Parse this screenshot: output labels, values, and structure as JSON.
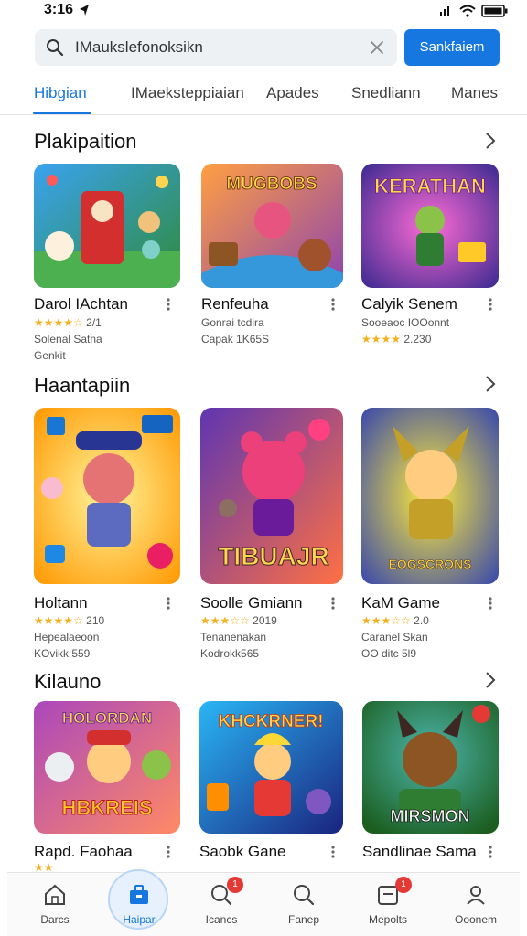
{
  "status": {
    "time": "3:16"
  },
  "search": {
    "query": "IMaukslefonoksikn",
    "button_label": "Sankfaiem"
  },
  "tabs": [
    {
      "label": "Hibgian",
      "active": true
    },
    {
      "label": "IMaeksteppiaian",
      "active": false
    },
    {
      "label": "Apades",
      "active": false
    },
    {
      "label": "Snedliann",
      "active": false
    },
    {
      "label": "Manes",
      "active": false
    }
  ],
  "sections": [
    {
      "title": "Plakipaition",
      "cards": [
        {
          "title": "Darol IAchtan",
          "line1": "2/1",
          "line1_stars": "★★★★☆",
          "line2": "Solenal Satna",
          "line3": "Genkit"
        },
        {
          "title": "Renfeuha",
          "line1": "Gonrai tcdira",
          "line1_stars": "",
          "line2": "Capak 1K65S",
          "line3": ""
        },
        {
          "title": "Calyik Senem",
          "line1": "Sooeaoc IOOonnt",
          "line1_stars": "",
          "line2": "2.230",
          "line2_stars": "★★★★",
          "line3": ""
        }
      ]
    },
    {
      "title": "Haantapiin",
      "cards": [
        {
          "title": "Holtann",
          "line1": "210",
          "line1_stars": "★★★★☆",
          "line2": "Hepealaeoon",
          "line3": "KOvikk 559"
        },
        {
          "title": "Soolle Gmiann",
          "line1": "2019",
          "line1_stars": "★★★☆☆",
          "line2": "Tenanenakan",
          "line3": "Kodrokk565"
        },
        {
          "title": "KaM Game",
          "line1": "2.0",
          "line1_stars": "★★★☆☆",
          "line2": "Caranel Skan",
          "line3": "OO ditc 5l9"
        }
      ]
    },
    {
      "title": "Kilauno",
      "cards": [
        {
          "title": "Rapd. Faohaa",
          "line1": "",
          "line1_stars": "★★",
          "line2": "",
          "line3": ""
        },
        {
          "title": "Saobk Gane",
          "line1": "",
          "line1_stars": "",
          "line2": "",
          "line3": ""
        },
        {
          "title": "Sandlinae Sama",
          "line1": "",
          "line1_stars": "",
          "line2": "",
          "line3": ""
        }
      ]
    }
  ],
  "art_texts": {
    "s1c2": "MUGBOBS",
    "s1c3": "KERATHAN",
    "s2c2": "TIBUAJR",
    "s2c3": "EOGSCRONS",
    "s3c1": "HOLORDAN",
    "s3c1b": "HBKREIS",
    "s3c2": "KHCKRNER!",
    "s3c3": "MIRSMON"
  },
  "bottom_nav": [
    {
      "label": "Darcs",
      "icon": "home-icon",
      "active": false,
      "badge": ""
    },
    {
      "label": "Haipar",
      "icon": "briefcase-icon",
      "active": true,
      "badge": ""
    },
    {
      "label": "Icancs",
      "icon": "search-badge-icon",
      "active": false,
      "badge": "1"
    },
    {
      "label": "Fanep",
      "icon": "search-icon",
      "active": false,
      "badge": ""
    },
    {
      "label": "Mepolts",
      "icon": "inbox-icon",
      "active": false,
      "badge": "1"
    },
    {
      "label": "Ooonem",
      "icon": "profile-icon",
      "active": false,
      "badge": ""
    }
  ],
  "colors": {
    "accent": "#1677e0",
    "star": "#f2b01e",
    "badge": "#e53935"
  }
}
